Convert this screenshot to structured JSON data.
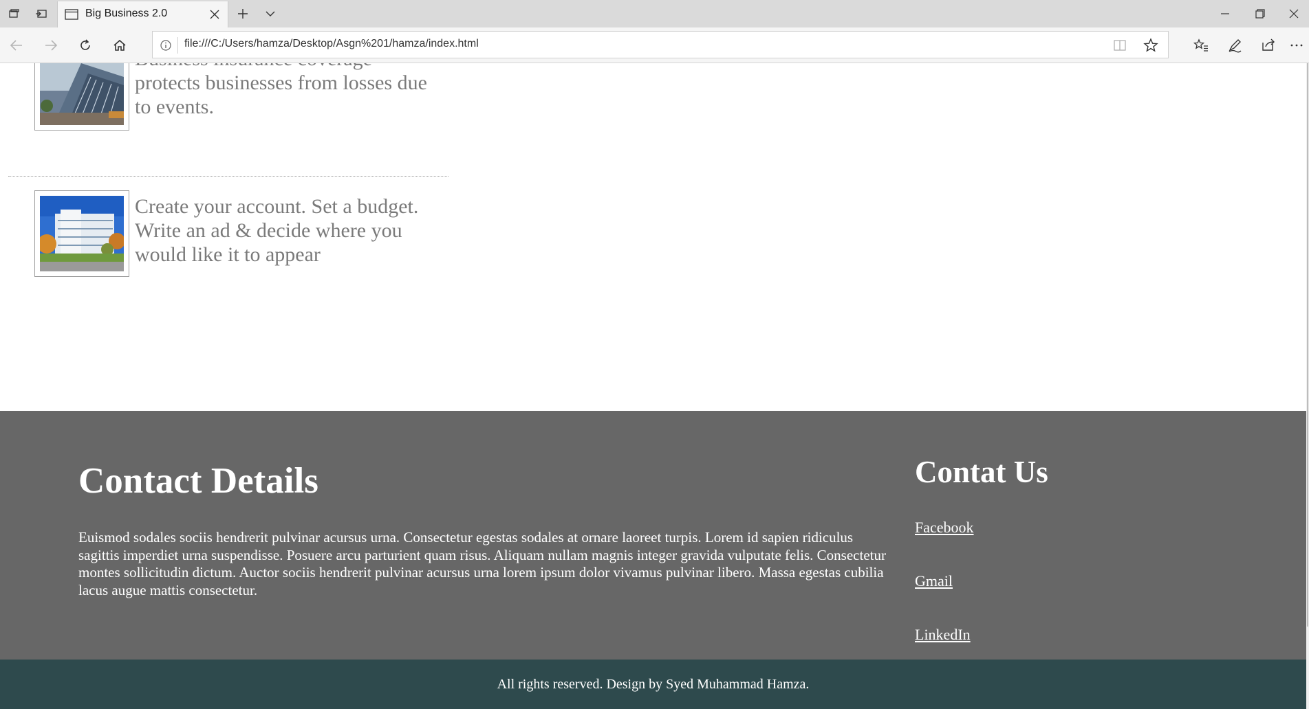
{
  "browser": {
    "tab_title": "Big Business 2.0",
    "url": "file:///C:/Users/hamza/Desktop/Asgn%201/hamza/index.html",
    "icons": [
      "set-aside-tabs-icon",
      "restore-tabs-icon",
      "page-icon",
      "close-icon",
      "plus-icon",
      "chevron-down-icon",
      "minimize-icon",
      "maximize-icon",
      "window-close-icon",
      "back-arrow-icon",
      "forward-arrow-icon",
      "refresh-icon",
      "home-icon",
      "info-icon",
      "reading-view-icon",
      "star-icon",
      "favorites-icon",
      "pen-icon",
      "share-icon",
      "more-icon"
    ]
  },
  "page": {
    "items": [
      {
        "text": "Business insurance coverage protects businesses from losses due to events."
      },
      {
        "text": "Create your account. Set a budget. Write an ad & decide where you would like it to appear"
      }
    ],
    "contact": {
      "heading": "Contact Details",
      "body": "Euismod sodales sociis hendrerit pulvinar acursus urna. Consectetur egestas sodales at ornare laoreet turpis. Lorem id sapien ridiculus sagittis imperdiet urna suspendisse. Posuere arcu parturient quam risus. Aliquam nullam magnis integer gravida vulputate felis. Consectetur montes sollicitudin dictum. Auctor sociis hendrerit pulvinar acursus urna lorem ipsum dolor vivamus pulvinar libero. Massa egestas cubilia lacus augue mattis consectetur."
    },
    "social": {
      "heading": "Contat Us",
      "links": [
        "Facebook",
        "Gmail",
        "LinkedIn"
      ]
    },
    "footer_text": "All rights reserved. Design by Syed Muhammad Hamza."
  },
  "colors": {
    "contact_bg": "#676767",
    "footer_bg": "#2e4a4d",
    "text_gray": "#7a7a7a"
  }
}
